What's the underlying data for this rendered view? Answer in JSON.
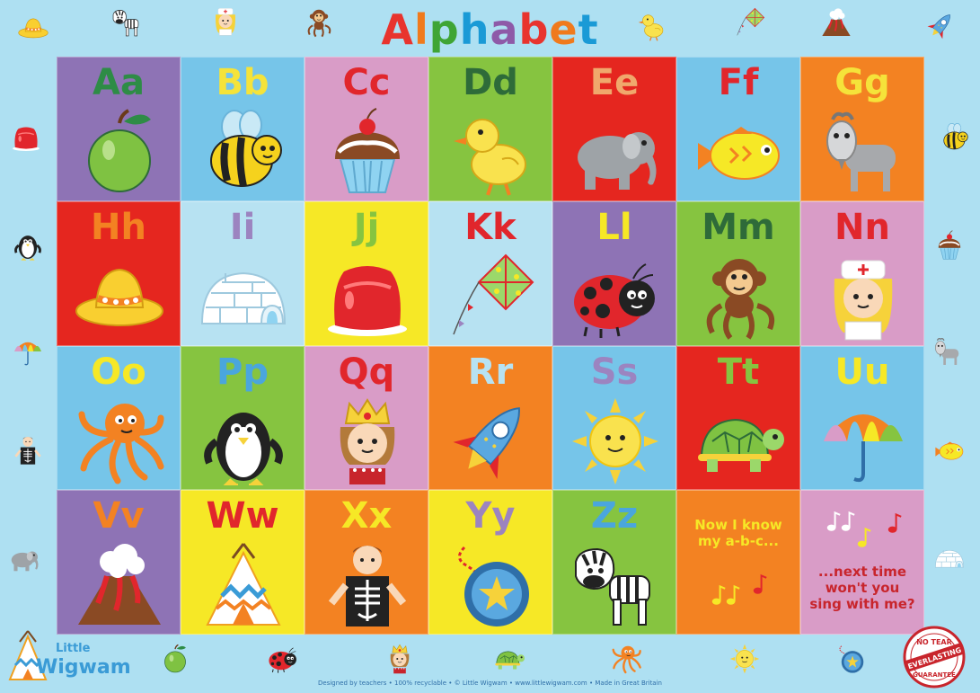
{
  "title": {
    "letters": [
      "A",
      "l",
      "p",
      "h",
      "a",
      "b",
      "e",
      "t"
    ],
    "colors": [
      "#e8342e",
      "#f07a1c",
      "#3fa535",
      "#1a9ad6",
      "#8e5aa8",
      "#e8342e",
      "#f07a1c",
      "#1a9ad6"
    ]
  },
  "cells": [
    {
      "letter": "Aa",
      "bg": "#8e73b5",
      "fg": "#2e8c46",
      "icon": "apple-icon"
    },
    {
      "letter": "Bb",
      "bg": "#76c5e9",
      "fg": "#f5e33a",
      "icon": "bee-icon"
    },
    {
      "letter": "Cc",
      "bg": "#d99cc7",
      "fg": "#e1262c",
      "icon": "cupcake-icon"
    },
    {
      "letter": "Dd",
      "bg": "#86c440",
      "fg": "#2e6b39",
      "icon": "duck-icon"
    },
    {
      "letter": "Ee",
      "bg": "#e5261f",
      "fg": "#f0a86c",
      "icon": "elephant-icon"
    },
    {
      "letter": "Ff",
      "bg": "#76c5e9",
      "fg": "#e1262c",
      "icon": "fish-icon"
    },
    {
      "letter": "Gg",
      "bg": "#f38222",
      "fg": "#f5e33a",
      "icon": "goat-icon"
    },
    {
      "letter": "Hh",
      "bg": "#e5261f",
      "fg": "#f38222",
      "icon": "hat-icon"
    },
    {
      "letter": "Ii",
      "bg": "#b7e2f2",
      "fg": "#9c84c0",
      "icon": "igloo-icon"
    },
    {
      "letter": "Jj",
      "bg": "#f6e826",
      "fg": "#86c440",
      "icon": "jelly-icon"
    },
    {
      "letter": "Kk",
      "bg": "#b7e2f2",
      "fg": "#e1262c",
      "icon": "kite-icon"
    },
    {
      "letter": "Ll",
      "bg": "#8e73b5",
      "fg": "#f6e826",
      "icon": "ladybird-icon"
    },
    {
      "letter": "Mm",
      "bg": "#86c440",
      "fg": "#2e6b39",
      "icon": "monkey-icon"
    },
    {
      "letter": "Nn",
      "bg": "#d99cc7",
      "fg": "#e1262c",
      "icon": "nurse-icon"
    },
    {
      "letter": "Oo",
      "bg": "#76c5e9",
      "fg": "#f6e826",
      "icon": "octopus-icon"
    },
    {
      "letter": "Pp",
      "bg": "#86c440",
      "fg": "#4aa6dd",
      "icon": "penguin-icon"
    },
    {
      "letter": "Qq",
      "bg": "#d99cc7",
      "fg": "#e1262c",
      "icon": "queen-icon"
    },
    {
      "letter": "Rr",
      "bg": "#f38222",
      "fg": "#b7e2f2",
      "icon": "rocket-icon"
    },
    {
      "letter": "Ss",
      "bg": "#76c5e9",
      "fg": "#9c84c0",
      "icon": "sun-icon"
    },
    {
      "letter": "Tt",
      "bg": "#e5261f",
      "fg": "#86c440",
      "icon": "turtle-icon"
    },
    {
      "letter": "Uu",
      "bg": "#76c5e9",
      "fg": "#f6e826",
      "icon": "umbrella-icon"
    },
    {
      "letter": "Vv",
      "bg": "#8e73b5",
      "fg": "#f38222",
      "icon": "volcano-icon"
    },
    {
      "letter": "Ww",
      "bg": "#f6e826",
      "fg": "#e1262c",
      "icon": "wigwam-icon"
    },
    {
      "letter": "Xx",
      "bg": "#f38222",
      "fg": "#f6e826",
      "icon": "x-ray-icon"
    },
    {
      "letter": "Yy",
      "bg": "#f6e826",
      "fg": "#9c84c0",
      "icon": "yoyo-icon"
    },
    {
      "letter": "Zz",
      "bg": "#86c440",
      "fg": "#4aa6dd",
      "icon": "zebra-icon"
    }
  ],
  "song": {
    "line1": "Now I know",
    "line2": "my a-b-c...",
    "line3": "...next time",
    "line4": "won't you",
    "line5": "sing with me?"
  },
  "logo": {
    "line1": "Little",
    "line2": "Wigwam"
  },
  "footer": "Designed by teachers • 100% recyclable • © Little Wigwam • www.littlewigwam.com • Made in Great Britain",
  "badge": {
    "top": "NO TEAR",
    "middle": "EVERLASTING",
    "bottom": "GUARANTEE"
  },
  "border_icons": [
    "hat-icon",
    "zebra-icon",
    "nurse-icon",
    "monkey-icon",
    "duck-icon",
    "kite-icon",
    "volcano-icon",
    "rocket-icon",
    "jelly-icon",
    "bee-icon",
    "penguin-icon",
    "cupcake-icon",
    "umbrella-icon",
    "goat-icon",
    "x-ray-icon",
    "fish-icon",
    "elephant-icon",
    "igloo-icon",
    "apple-icon",
    "ladybird-icon",
    "queen-icon",
    "turtle-icon",
    "octopus-icon",
    "sun-icon",
    "yoyo-icon"
  ]
}
